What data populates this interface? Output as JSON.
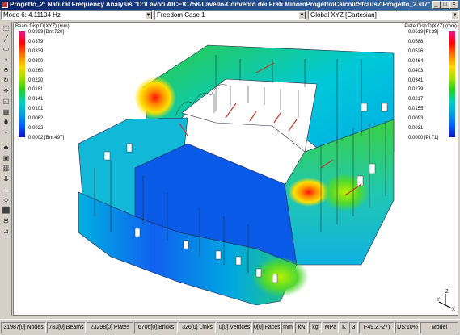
{
  "window": {
    "title": "Progetto_2: Natural Frequency Analysis \"D:\\Lavori AICE\\C758-Lavello-Convento dei Frati Minori\\Progetto\\Calcoli\\Straus7\\Progetto_2.st7\""
  },
  "dropdowns": {
    "mode": "Mode 6: 4.11104 Hz",
    "case": "Freedom Case 1",
    "coord": "Global XYZ [Cartesian]"
  },
  "toolbar_icons": [
    "select-icon",
    "line-icon",
    "rectangle-icon",
    "node-icon",
    "zoom-icon",
    "rotate-icon",
    "pan-icon",
    "view-icon",
    "mesh-icon",
    "cylinder-icon",
    "filter-icon",
    "element-icon",
    "brick-icon",
    "link-icon",
    "load-icon",
    "support-icon",
    "plate-icon",
    "cube-icon",
    "grid-icon",
    "axis-icon"
  ],
  "legend_beam": {
    "title": "Beam Disp:D(XYZ) (mm)",
    "values": [
      "0.0399 [Bm:720]",
      "0.0379",
      "0.0339",
      "0.0300",
      "0.0260",
      "0.0220",
      "0.0181",
      "0.0141",
      "0.0101",
      "0.0062",
      "0.0022",
      "0.0002 [Bm:497]"
    ]
  },
  "legend_plate": {
    "title": "Plate Disp:D(XYZ) (mm)",
    "values": [
      "0.0619 [Pl:39]",
      "0.0588",
      "0.0526",
      "0.0464",
      "0.0403",
      "0.0341",
      "0.0279",
      "0.0217",
      "0.0155",
      "0.0093",
      "0.0031",
      "0.0000 [Pl:71]"
    ]
  },
  "triad": {
    "z": "Z",
    "y": "Y",
    "x": "X"
  },
  "status": {
    "nodes": "31987[0] Nodes",
    "beams": "783[0] Beams",
    "plates": "23298[0] Plates",
    "bricks": "6706[0] Bricks",
    "links": "326[0] Links",
    "vertices": "0[0] Vertices",
    "faces": "0[0] Faces",
    "unit_length": "mm",
    "unit_force": "kN",
    "unit_mass": "kg",
    "unit_stress": "MPa",
    "unit_temp": "K",
    "value_3": "3",
    "coords": "(-49,2,-27)",
    "ds": "DS:10%",
    "model": "Model"
  }
}
